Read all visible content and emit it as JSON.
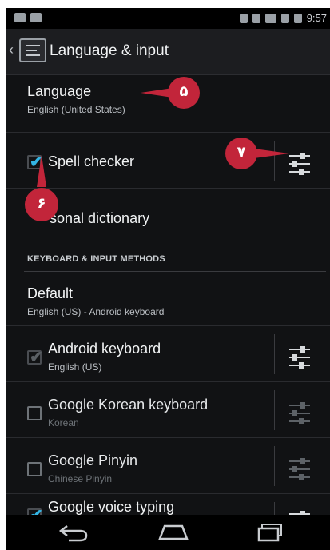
{
  "status_bar": {
    "time": "9:57"
  },
  "action_bar": {
    "title": "Language & input"
  },
  "language": {
    "title": "Language",
    "summary": "English (United States)"
  },
  "spell_checker": {
    "label": "Spell checker",
    "checked": true
  },
  "personal_dictionary": {
    "label": "sonal dictionary"
  },
  "section_header": "KEYBOARD & INPUT METHODS",
  "default_keyboard": {
    "title": "Default",
    "summary": "English (US) - Android keyboard"
  },
  "input_methods": [
    {
      "title": "Android keyboard",
      "summary": "English (US)",
      "checked": true,
      "enabled": true
    },
    {
      "title": "Google Korean keyboard",
      "summary": "Korean",
      "checked": false,
      "enabled": false
    },
    {
      "title": "Google Pinyin",
      "summary": "Chinese Pinyin",
      "checked": false,
      "enabled": false
    },
    {
      "title": "Google voice typing",
      "summary": "",
      "checked": true,
      "enabled": true
    }
  ],
  "callouts": [
    {
      "number": "۵"
    },
    {
      "number": "۶"
    },
    {
      "number": "۷"
    }
  ],
  "colors": {
    "callout": "#c2253a",
    "checkbox_accent": "#33b5e5",
    "background": "#111214"
  },
  "icons": [
    "back-arrow-icon",
    "settings-sliders-icon",
    "nav-back-icon",
    "nav-home-icon",
    "nav-recents-icon"
  ]
}
